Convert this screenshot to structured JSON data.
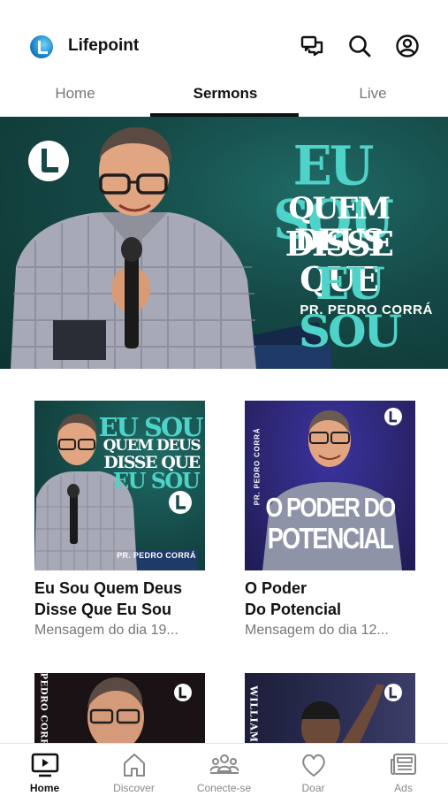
{
  "header": {
    "app_title": "Lifepoint",
    "icons": [
      "chat-icon",
      "search-icon",
      "profile-icon"
    ]
  },
  "tabs": [
    {
      "label": "Home",
      "active": false
    },
    {
      "label": "Sermons",
      "active": true
    },
    {
      "label": "Live",
      "active": false
    }
  ],
  "hero": {
    "line1": "EU SOU",
    "line2": "QUEM DEUS",
    "line3": "DISSE QUE",
    "line4": "EU SOU",
    "pastor": "PR. PEDRO CORRÁ",
    "logo_letter": "L"
  },
  "cards": [
    {
      "title": "Eu Sou Quem Deus\nDisse Que Eu Sou",
      "subtitle": "Mensagem do dia 19...",
      "thumb": {
        "line1": "EU SOU",
        "line2": "QUEM DEUS",
        "line3": "DISSE QUE",
        "line4": "EU SOU",
        "pastor": "PR. PEDRO CORRÁ"
      }
    },
    {
      "title": "O Poder\nDo Potencial",
      "subtitle": "Mensagem do dia 12...",
      "thumb": {
        "line1": "O PODER DO",
        "line2": "POTENCIAL",
        "side": "PR. PEDRO CORRÁ"
      }
    },
    {
      "thumb": {
        "side": "PEDRO CORRÁ"
      }
    },
    {
      "thumb": {
        "side": "WILLIAM"
      }
    }
  ],
  "bottom_nav": [
    {
      "label": "Home",
      "icon": "tv-icon",
      "active": true
    },
    {
      "label": "Discover",
      "icon": "house-icon",
      "active": false
    },
    {
      "label": "Conecte-se",
      "icon": "people-icon",
      "active": false
    },
    {
      "label": "Doar",
      "icon": "heart-icon",
      "active": false
    },
    {
      "label": "Ads",
      "icon": "news-icon",
      "active": false
    }
  ],
  "colors": {
    "teal_title": "#4fd3c8",
    "hero_bg": "#154946",
    "purple_bg": "#2c2670",
    "dark_bg": "#1a1214"
  }
}
